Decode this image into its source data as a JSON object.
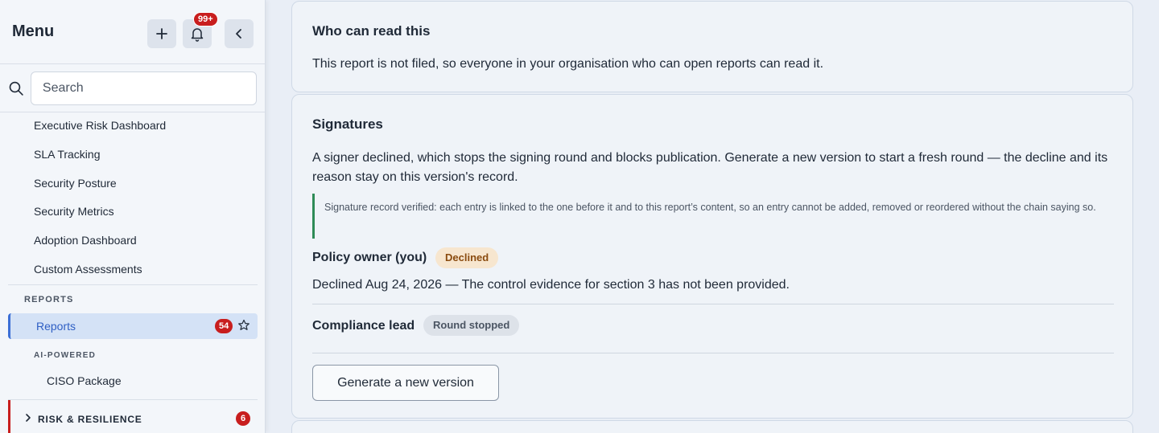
{
  "sidebar": {
    "title": "Menu",
    "notifications_badge": "99+",
    "search": {
      "placeholder": "Search",
      "value": ""
    },
    "items": [
      {
        "label": "Executive Risk Dashboard"
      },
      {
        "label": "SLA Tracking"
      },
      {
        "label": "Security Posture"
      },
      {
        "label": "Security Metrics"
      },
      {
        "label": "Adoption Dashboard"
      },
      {
        "label": "Custom Assessments"
      }
    ],
    "reports_section": "REPORTS",
    "reports_item": {
      "label": "Reports",
      "count": "54"
    },
    "ai_section": "AI-POWERED",
    "ai_item": {
      "label": "CISO Package"
    },
    "risk_group": {
      "label": "RISK & RESILIENCE",
      "count": "6"
    }
  },
  "access_card": {
    "title": "Who can read this",
    "text": "This report is not filed, so everyone in your organisation who can open reports can read it."
  },
  "signatures_card": {
    "title": "Signatures",
    "text": "A signer declined, which stops the signing round and blocks publication. Generate a new version to start a fresh round — the decline and its reason stay on this version's record.",
    "verification_note": "Signature record verified: each entry is linked to the one before it and to this report’s content, so an entry cannot be added, removed or reordered without the chain saying so.",
    "signers": [
      {
        "role": "Policy owner (you)",
        "status": "Declined",
        "detail": "Declined Aug 24, 2026 — The control evidence for section 3 has not been provided."
      },
      {
        "role": "Compliance lead",
        "status": "Round stopped"
      }
    ],
    "action_label": "Generate a new version"
  },
  "colors": {
    "accent": "#3b6fd6",
    "badge_red": "#c81e1e",
    "verified_green": "#2e8b57",
    "declined_bg": "#f7e6cf"
  }
}
